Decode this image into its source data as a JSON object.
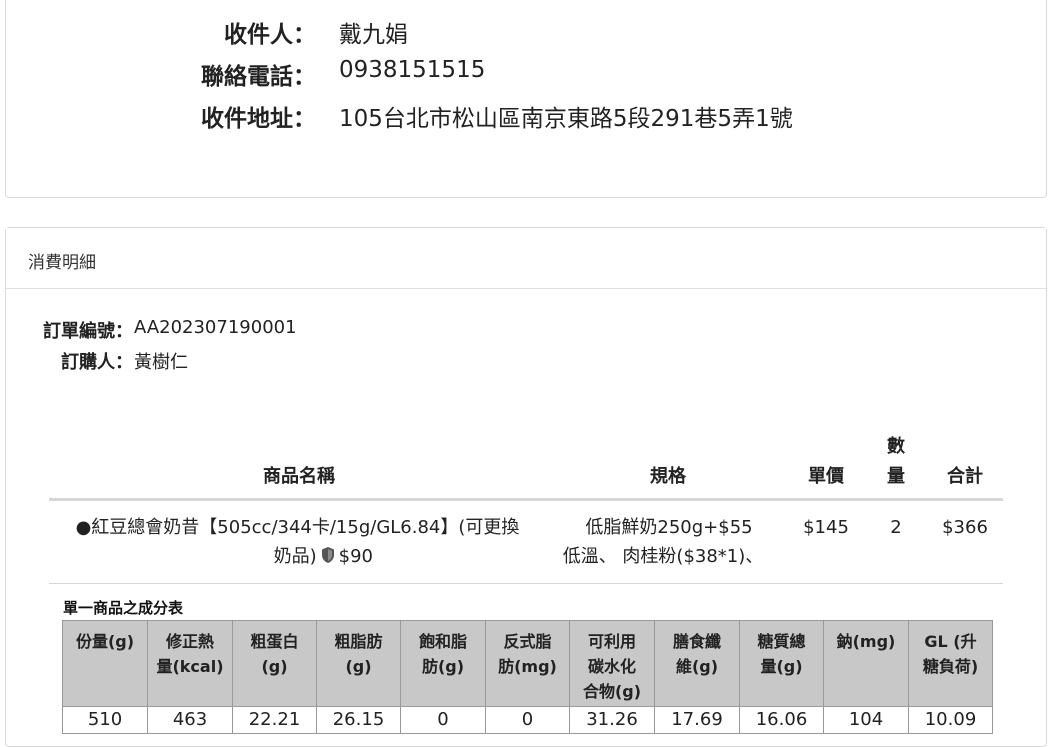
{
  "recipient": {
    "name_label": "收件人：",
    "name_value": "戴九娟",
    "phone_label": "聯絡電話：",
    "phone_value": "0938151515",
    "address_label": "收件地址：",
    "address_value": "105台北市松山區南京東路5段291巷5弄1號"
  },
  "detail": {
    "title": "消費明細",
    "order_no_label": "訂單編號：",
    "order_no_value": "AA202307190001",
    "buyer_label": "訂購人：",
    "buyer_value": "黃樹仁"
  },
  "order_table": {
    "headers": {
      "name": "商品名稱",
      "spec": "規格",
      "price": "單價",
      "qty_line1": "數",
      "qty_line2": "量",
      "total": "合計"
    },
    "rows": [
      {
        "name_line1": "●紅豆總會奶昔【505cc/344卡/15g/GL6.84】(可更換",
        "name_line2_pre": "奶品)",
        "name_icon": "shield-icon",
        "name_line2_post": "$90",
        "spec_line1": "低脂鮮奶250g+$55",
        "spec_line2": "低溫、 肉桂粉($38*1)、",
        "price": "$145",
        "qty": "2",
        "total": "$366"
      }
    ]
  },
  "nutrition": {
    "title": "單一商品之成分表",
    "headers": [
      "份量(g)",
      "修正熱量(kcal)",
      "粗蛋白(g)",
      "粗脂肪(g)",
      "飽和脂肪(g)",
      "反式脂肪(mg)",
      "可利用碳水化合物(g)",
      "膳食纖維(g)",
      "糖質總量(g)",
      "鈉(mg)",
      "GL (升糖負荷)"
    ],
    "header_display": [
      [
        "份量(g)"
      ],
      [
        "修正熱",
        "量(kcal)"
      ],
      [
        "粗蛋白",
        "(g)"
      ],
      [
        "粗脂肪",
        "(g)"
      ],
      [
        "飽和脂",
        "肪(g)"
      ],
      [
        "反式脂",
        "肪(mg)"
      ],
      [
        "可利用",
        "碳水化",
        "合物(g)"
      ],
      [
        "膳食纖",
        "維(g)"
      ],
      [
        "糖質總",
        "量(g)"
      ],
      [
        "鈉(mg)"
      ],
      [
        "GL (升",
        "糖負荷)"
      ]
    ],
    "values": [
      "510",
      "463",
      "22.21",
      "26.15",
      "0",
      "0",
      "31.26",
      "17.69",
      "16.06",
      "104",
      "10.09"
    ]
  },
  "colors": {
    "border": "#d9d9d9",
    "table_header_bg": "#c8c8c8",
    "text": "#222222"
  }
}
